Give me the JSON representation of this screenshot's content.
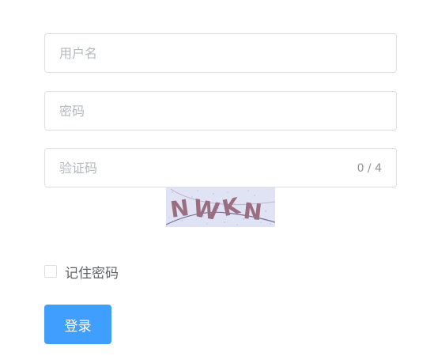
{
  "form": {
    "username": {
      "placeholder": "用户名",
      "value": ""
    },
    "password": {
      "placeholder": "密码",
      "value": ""
    },
    "captcha": {
      "placeholder": "验证码",
      "value": "",
      "word_count": "0 / 4"
    },
    "captcha_image": {
      "text": "NWKN",
      "background": "#dfe3f3",
      "text_color": "#9a6e80"
    },
    "remember": {
      "label": "记住密码",
      "checked": false
    },
    "submit_label": "登录"
  },
  "colors": {
    "primary": "#409eff",
    "border": "#dcdfe6",
    "placeholder": "#b4b8bf",
    "text": "#606266"
  }
}
